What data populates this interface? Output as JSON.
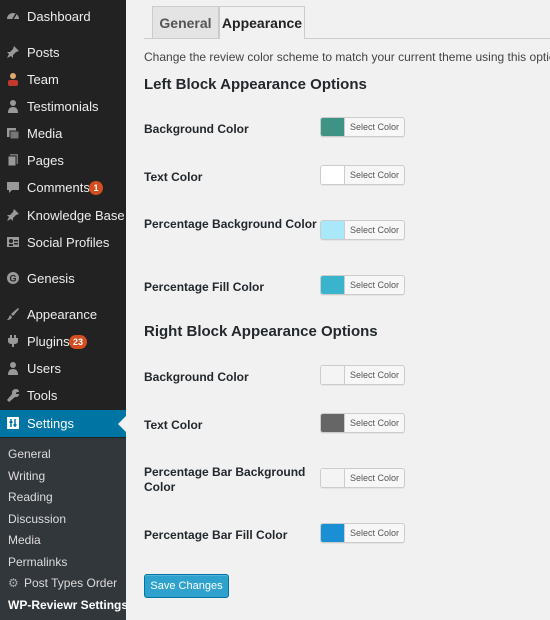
{
  "sidebar": {
    "dashboard": {
      "label": "Dashboard",
      "icon": "dashboard-icon"
    },
    "posts": {
      "label": "Posts",
      "icon": "pin-icon"
    },
    "team": {
      "label": "Team",
      "icon": "team-icon"
    },
    "testimonials": {
      "label": "Testimonials",
      "icon": "user-icon"
    },
    "media": {
      "label": "Media",
      "icon": "media-icon"
    },
    "pages": {
      "label": "Pages",
      "icon": "pages-icon"
    },
    "comments": {
      "label": "Comments",
      "icon": "comment-icon",
      "badge": "1"
    },
    "knowledge_base": {
      "label": "Knowledge Base",
      "icon": "pin-icon"
    },
    "social_profiles": {
      "label": "Social Profiles",
      "icon": "profile-card-icon"
    },
    "genesis": {
      "label": "Genesis",
      "icon": "genesis-icon"
    },
    "appearance": {
      "label": "Appearance",
      "icon": "brush-icon"
    },
    "plugins": {
      "label": "Plugins",
      "icon": "plugin-icon",
      "badge": "23"
    },
    "users": {
      "label": "Users",
      "icon": "user-icon"
    },
    "tools": {
      "label": "Tools",
      "icon": "wrench-icon"
    },
    "settings": {
      "label": "Settings",
      "icon": "settings-icon"
    }
  },
  "submenu": {
    "general": "General",
    "writing": "Writing",
    "reading": "Reading",
    "discussion": "Discussion",
    "media": "Media",
    "permalinks": "Permalinks",
    "post_types_order": "Post Types Order",
    "wp_reviewr": "WP-Reviewr Settings"
  },
  "tabs": {
    "general": "General",
    "appearance": "Appearance"
  },
  "intro": "Change the review color scheme to match your current theme using this options.",
  "left_block": {
    "title": "Left Block Appearance Options",
    "fields": [
      {
        "label": "Background Color",
        "color": "#3f9384"
      },
      {
        "label": "Text Color",
        "color": "#ffffff"
      },
      {
        "label": "Percentage Background Color",
        "color": "#a8e8f8"
      },
      {
        "label": "Percentage Fill Color",
        "color": "#3ab3cc"
      }
    ]
  },
  "right_block": {
    "title": "Right Block Appearance Options",
    "fields": [
      {
        "label": "Background Color",
        "color": "#f4f4f4"
      },
      {
        "label": "Text Color",
        "color": "#666666"
      },
      {
        "label": "Percentage Bar Background Color",
        "color": "#f4f4f4"
      },
      {
        "label": "Percentage Bar Fill Color",
        "color": "#1a8fd4"
      }
    ]
  },
  "select_color_label": "Select Color",
  "save_button": "Save Changes"
}
